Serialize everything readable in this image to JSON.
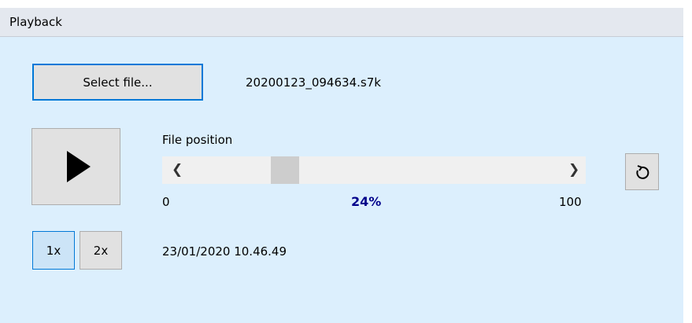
{
  "header": {
    "title": "Playback"
  },
  "file": {
    "select_label": "Select file...",
    "filename": "20200123_094634.s7k"
  },
  "controls": {
    "play_icon": "play-icon",
    "loop_icon": "loop-icon"
  },
  "position": {
    "label": "File position",
    "min_label": "0",
    "max_label": "100",
    "percent_label": "24%",
    "value": 24
  },
  "speed": {
    "options": [
      "1x",
      "2x"
    ],
    "selected": "1x"
  },
  "timestamp": "23/01/2020 10.46.49",
  "colors": {
    "accent": "#0078d7",
    "panel_bg": "#dceffd",
    "percent_text": "#00008b"
  }
}
